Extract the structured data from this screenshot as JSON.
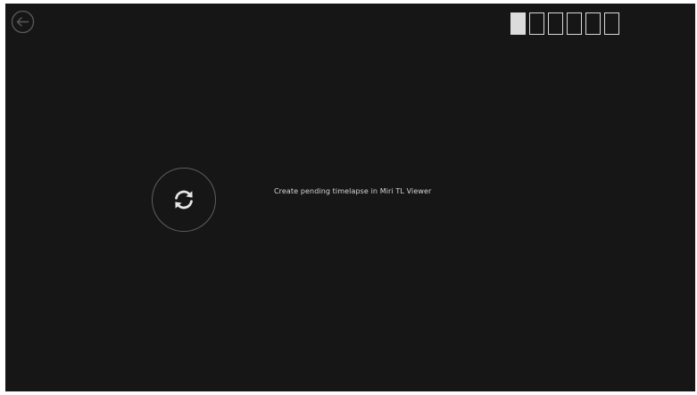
{
  "navigation": {
    "back_icon": "arrow-left-circle-icon"
  },
  "progress": {
    "total_steps": 6,
    "completed_steps": 1
  },
  "refresh": {
    "icon": "refresh-icon"
  },
  "status": {
    "message": "Create pending timelapse in Miri TL Viewer"
  },
  "colors": {
    "background": "#161616",
    "foreground": "#d6d6d6",
    "outline": "#5e5e5e"
  }
}
